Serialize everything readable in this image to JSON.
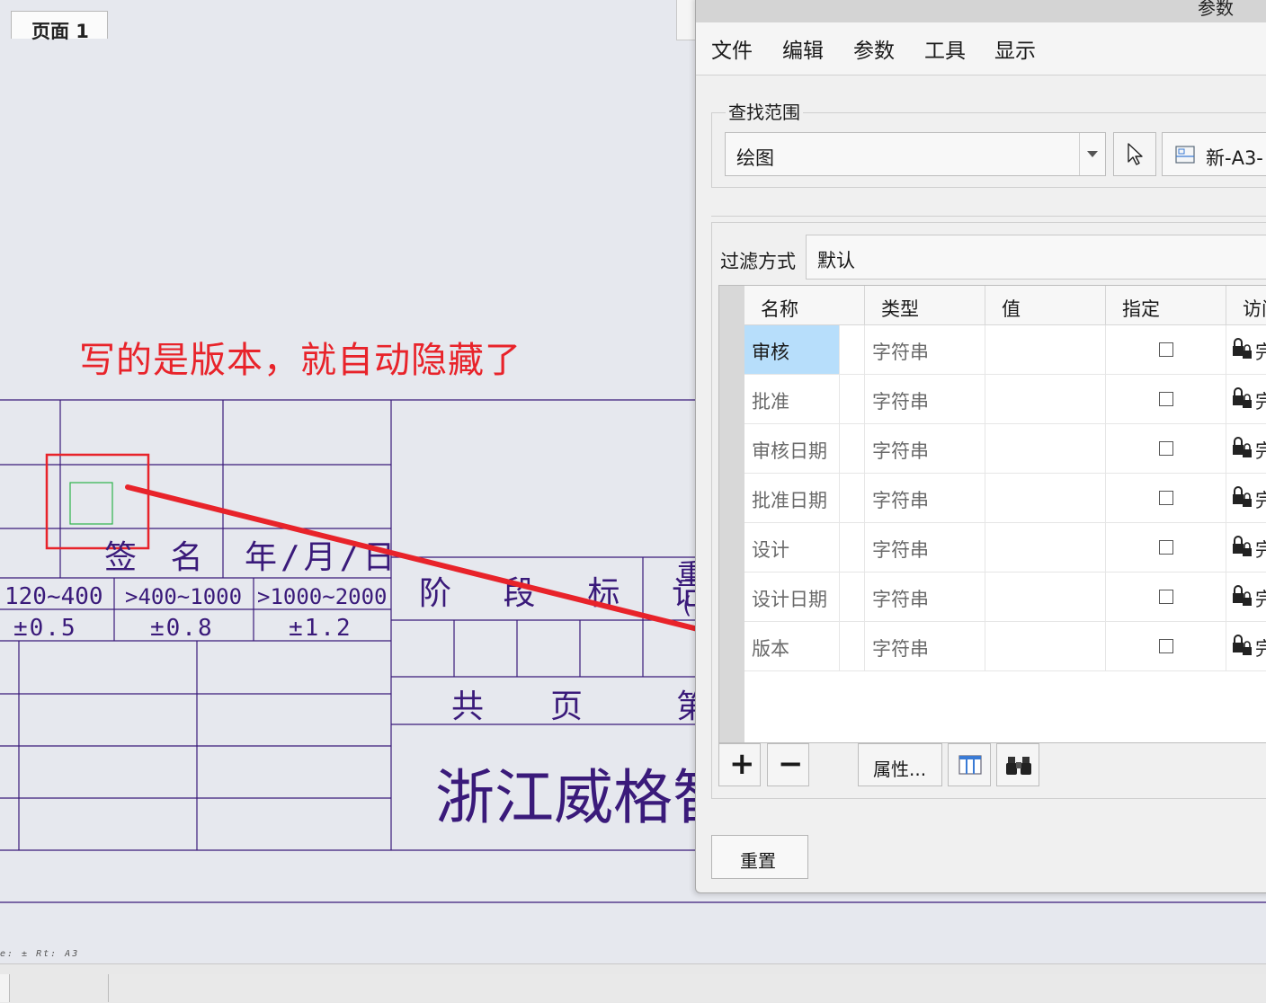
{
  "drawing": {
    "annotation": "写的是版本，就自动隐藏了",
    "title_block": {
      "sign_label": "签 名",
      "date_label": "年/月/日",
      "ranges": [
        "120~400",
        ">400~1000",
        ">1000~2000"
      ],
      "tolerances": [
        "±0.5",
        "±0.8",
        "±1.2"
      ],
      "stage_label": "阶 段 标 记",
      "weight_partial": "重",
      "paren_partial": "(",
      "total_label": "共",
      "page_label": "页",
      "nth_partial": "第",
      "company_partial": "浙江威格智能"
    },
    "status_text": "e:  ±   Rt:  A3"
  },
  "tabs": {
    "page_tab": "页面 1"
  },
  "dialog": {
    "title": "参数",
    "menu": [
      "文件",
      "编辑",
      "参数",
      "工具",
      "显示"
    ],
    "search_scope_label": "查找范围",
    "scope_value": "绘图",
    "model_name": "新-A3-",
    "filter_label": "过滤方式",
    "filter_value": "默认",
    "table": {
      "headers": [
        "名称",
        "类型",
        "值",
        "指定",
        "访问"
      ],
      "rows": [
        {
          "name": "审核",
          "type": "字符串",
          "value": "",
          "access": "完"
        },
        {
          "name": "批准",
          "type": "字符串",
          "value": "",
          "access": "完"
        },
        {
          "name": "审核日期",
          "type": "字符串",
          "value": "",
          "access": "完"
        },
        {
          "name": "批准日期",
          "type": "字符串",
          "value": "",
          "access": "完"
        },
        {
          "name": "设计",
          "type": "字符串",
          "value": "",
          "access": "完"
        },
        {
          "name": "设计日期",
          "type": "字符串",
          "value": "",
          "access": "完"
        },
        {
          "name": "版本",
          "type": "字符串",
          "value": "",
          "access": "完"
        }
      ]
    },
    "buttons": {
      "add": "+",
      "remove": "−",
      "properties": "属性...",
      "reset": "重置"
    }
  },
  "colors": {
    "annotation_red": "#e8232a",
    "cad_line": "#3a1a7a",
    "selection_blue": "#b7defb"
  }
}
